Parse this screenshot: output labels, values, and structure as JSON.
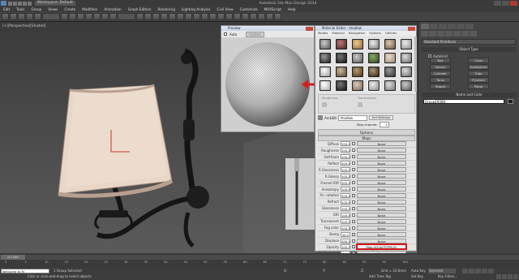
{
  "window": {
    "title": "Autodesk 3ds Max Design 2014",
    "workspace": "Workspace: Default"
  },
  "menu": [
    "Edit",
    "Tools",
    "Group",
    "Views",
    "Create",
    "Modifiers",
    "Animation",
    "Graph Editors",
    "Rendering",
    "Lighting Analysis",
    "Civil View",
    "Customize",
    "MAXScript",
    "Help"
  ],
  "viewport": {
    "label": "[+][Perspective][Shaded]"
  },
  "preview_window": {
    "title": "Preview",
    "auto_label": "Auto",
    "update_label": "Update"
  },
  "material_editor": {
    "title": "Material Editor - lmadow",
    "menu": [
      "Modes",
      "Material",
      "Navigation",
      "Options",
      "Utilities"
    ],
    "params": {
      "left": "Roughness",
      "right": "Translucency"
    },
    "name_row": {
      "label": "Arc&Elli",
      "material_name": "lmadow",
      "type_label": "Arch&Design"
    },
    "map_channel_label": "Map channel:",
    "map_channel_value": "1",
    "rollouts": {
      "options": "Options",
      "maps": "Maps",
      "mapped_interp": "Refract Interpolation"
    },
    "maps": [
      {
        "label": "Diffuse",
        "value": "100.0",
        "map": "None",
        "highlight": false
      },
      {
        "label": "Roughness",
        "value": "100.0",
        "map": "None",
        "highlight": false
      },
      {
        "label": "Self-Illum",
        "value": "100.0",
        "map": "None",
        "highlight": false
      },
      {
        "label": "Reflect",
        "value": "100.0",
        "map": "None",
        "highlight": false
      },
      {
        "label": "R.Glossiness",
        "value": "100.0",
        "map": "None",
        "highlight": false
      },
      {
        "label": "R.Glossy",
        "value": "100.0",
        "map": "None",
        "highlight": false
      },
      {
        "label": "Fresnel IOR",
        "value": "100.0",
        "map": "None",
        "highlight": false
      },
      {
        "label": "Anisotropy",
        "value": "100.0",
        "map": "None",
        "highlight": false
      },
      {
        "label": "An. rotation",
        "value": "100.0",
        "map": "None",
        "highlight": false
      },
      {
        "label": "Refract",
        "value": "100.0",
        "map": "None",
        "highlight": false
      },
      {
        "label": "Glossiness",
        "value": "100.0",
        "map": "None",
        "highlight": false
      },
      {
        "label": "IOR",
        "value": "100.0",
        "map": "None",
        "highlight": false
      },
      {
        "label": "Translucent",
        "value": "100.0",
        "map": "None",
        "highlight": false
      },
      {
        "label": "Fog color",
        "value": "100.0",
        "map": "None",
        "highlight": false
      },
      {
        "label": "Bump",
        "value": "30.0",
        "map": "None",
        "highlight": false
      },
      {
        "label": "Displace",
        "value": "100.0",
        "map": "None",
        "highlight": false
      },
      {
        "label": "Opacity",
        "value": "100.0",
        "map": "Map #2(AOTCPM-D) (1_bump.jpg)",
        "highlight": true
      },
      {
        "label": "Environment",
        "value": "",
        "map": "None",
        "highlight": false
      }
    ]
  },
  "command_panel": {
    "dropdown": "Standard Primitives",
    "rollout_title": "Object Type",
    "autogrid_label": "AutoGrid",
    "buttons": [
      "Box",
      "Cone",
      "Sphere",
      "GeoSphere",
      "Cylinder",
      "Tube",
      "Torus",
      "Pyramid",
      "Teapot",
      "Plane"
    ],
    "name_color_title": "Name and Color",
    "object_name": "Group49368"
  },
  "timeline": {
    "frame": "0 / 100",
    "ticks": [
      "0",
      "5",
      "10",
      "15",
      "20",
      "25",
      "30",
      "35",
      "40",
      "45",
      "50",
      "55",
      "60",
      "65",
      "70",
      "75",
      "80",
      "85",
      "90",
      "95",
      "100"
    ]
  },
  "status": {
    "selection": "1 Group Selected",
    "prompt": "Click or click-and-drag to select objects",
    "welcome": "Welcome to M",
    "coords": {
      "x": "X:",
      "y": "Y:",
      "z": "Z:",
      "grid": "Grid = 10,0mm"
    },
    "auto_key": "Auto Key",
    "set_key": "Set Key",
    "selected": "Selected",
    "key_filters": "Key Filters...",
    "add_time_tag": "Add Time Tag"
  }
}
